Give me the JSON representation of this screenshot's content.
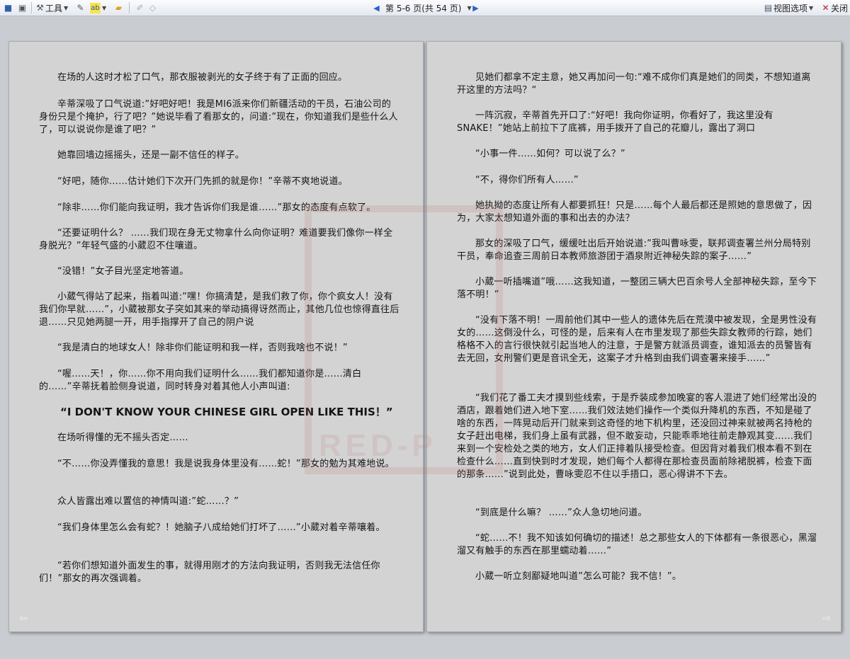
{
  "toolbar": {
    "tools_label": "工具",
    "page_info": "第 5-6 页(共 54 页)",
    "view_options_label": "视图选项",
    "close_label": "关闭"
  },
  "icons": {
    "save": "save-icon",
    "print_preview": "print-preview-icon",
    "tools": "tools-icon",
    "research": "research-icon",
    "highlight": "highlight-icon",
    "folder": "folder-icon",
    "prev_page": "prev-page-icon",
    "next_page": "next-page-icon",
    "view_options": "view-options-icon"
  },
  "left_page": {
    "paragraphs": [
      "在场的人这时才松了口气，那衣服被剥光的女子终于有了正面的回应。",
      "辛蒂深吸了口气说道:”好吧好吧！我是MI6派来你们新疆活动的干员，石油公司的身份只是个掩护，行了吧？”她说毕看了看那女的，问道:”现在，你知道我们是些什么人了，可以说说你是谁了吧？”",
      "她靠回墙边摇摇头，还是一副不信任的样子。",
      "“好吧，随你……估计她们下次开门先抓的就是你！”辛蒂不爽地说道。",
      "“除非……你们能向我证明，我才告诉你们我是谁……”那女的态度有点软了。",
      "“还要证明什么？ ……我们现在身无丈物拿什么向你证明？难道要我们像你一样全身脱光？”年轻气盛的小葳忍不住嚷道。",
      "“没错！”女子目光坚定地答道。",
      "小葳气得站了起来，指着叫道:”嘿！你搞清楚，是我们救了你，你个疯女人！没有我们你早就……”，小葳被那女子突如其来的举动搞得讶然而止，其他几位也惊得直往后退……只见她两腿一开，用手指撑开了自己的阴户说",
      "“我是清白的地球女人！除非你们能证明和我一样，否则我啥也不说！”",
      "“喔……天！，你……你不用向我们证明什么……我们都知道你是……清白的……”辛蒂抚着脸侧身说道，同时转身对着其他人小声叫道:",
      "“I DON'T KNOW YOUR CHINESE GIRL OPEN LIKE THIS！”",
      "在场听得懂的无不摇头否定……",
      "“不……你没弄懂我的意思！我是说我身体里没有……蛇！”那女的勉为其难地说。",
      "众人皆露出难以置信的神情叫道:”蛇……？”",
      "“我们身体里怎么会有蛇？！她脑子八成给她们打坏了……”小葳对着辛蒂嚷着。",
      "“若你们想知道外面发生的事，就得用刚才的方法向我证明，否则我无法信任你们！”那女的再次强调着。"
    ]
  },
  "right_page": {
    "paragraphs": [
      "见她们都拿不定主意，她又再加问一句:“难不成你们真是她们的同类，不想知道离开这里的方法吗？“",
      "一阵沉寂，辛蒂首先开口了:“好吧！我向你证明，你看好了，我这里没有SNAKE！”她站上前拉下了底裤，用手拨开了自己的花瓣儿，露出了洞口",
      "“小事一件……如何？可以说了么？”",
      "“不，得你们所有人……”",
      "她执拗的态度让所有人都要抓狂！只是……每个人最后都还是照她的意思做了，因为，大家太想知道外面的事和出去的办法？",
      "那女的深吸了口气，缓缓吐出后开始说道:”我叫曹咏雯，联邦调查署兰州分局特别干员，奉命追查三周前日本教师旅游团于酒泉附近神秘失踪的案子……”",
      "小葳一听插嘴道”哦……这我知道，一整团三辆大巴百余号人全部神秘失踪，至今下落不明！”",
      "“没有下落不明！一周前他们其中一些人的遗体先后在荒漠中被发现，全是男性没有女的……这倒没什么，可怪的是，后来有人在市里发现了那些失踪女教师的行踪，她们格格不入的言行很快就引起当地人的注意，于是警方就派员调查，谁知派去的员警皆有去无回，女刑警们更是音讯全无，这案子才升格到由我们调查署来接手……”",
      "“我们花了番工夫才摸到些线索，于是乔装成参加晚宴的客人混进了她们经常出没的酒店，跟着她们进入地下室……我们效法她们操作一个类似升降机的东西，不知是碰了啥的东西，一阵晃动后开门就来到这奇怪的地下机构里，还没回过神来就被两名持枪的女子赶出电梯，我们身上虽有武器，但不敢妄动，只能乖乖地往前走静观其变……我们来到一个安检处之类的地方，女人们正排着队接受检查。但因背对着我们根本看不到在检查什么……直到快到时才发现，她们每个人都得在那检查员面前除裙脱裤，检查下面的那条……”说到此处，曹咏雯忍不住以手捂口，恶心得讲不下去。",
      "“到底是什么嘛？ ……”众人急切地问道。",
      "“蛇……不！我不知该如何确切的描述！总之那些女人的下体都有一条很恶心，黑溜溜又有触手的东西在那里蠕动着……”",
      "小葳一听立刻鄙疑地叫道”怎么可能？我不信！”。"
    ]
  },
  "watermark_text": "RED-P"
}
